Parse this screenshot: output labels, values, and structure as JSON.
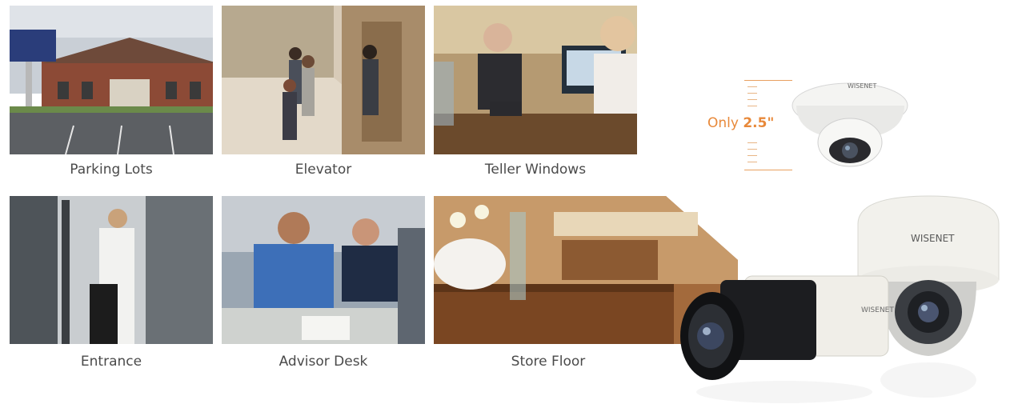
{
  "tiles": [
    {
      "caption": "Parking Lots",
      "scene": "bank building with parking lot"
    },
    {
      "caption": "Elevator",
      "scene": "people waiting at elevator"
    },
    {
      "caption": "Teller Windows",
      "scene": "teller with customer at window"
    },
    {
      "caption": "Entrance",
      "scene": "woman passing through glass door"
    },
    {
      "caption": "Advisor Desk",
      "scene": "advisor meeting with clients"
    },
    {
      "caption": "Store Floor",
      "scene": "hotel lobby counter"
    }
  ],
  "callout": {
    "prefix": "Only ",
    "value": "2.5\""
  },
  "brand": {
    "logo_text": "WISENET"
  },
  "colors": {
    "accent": "#e8893a",
    "caption": "#4a4a4a"
  }
}
